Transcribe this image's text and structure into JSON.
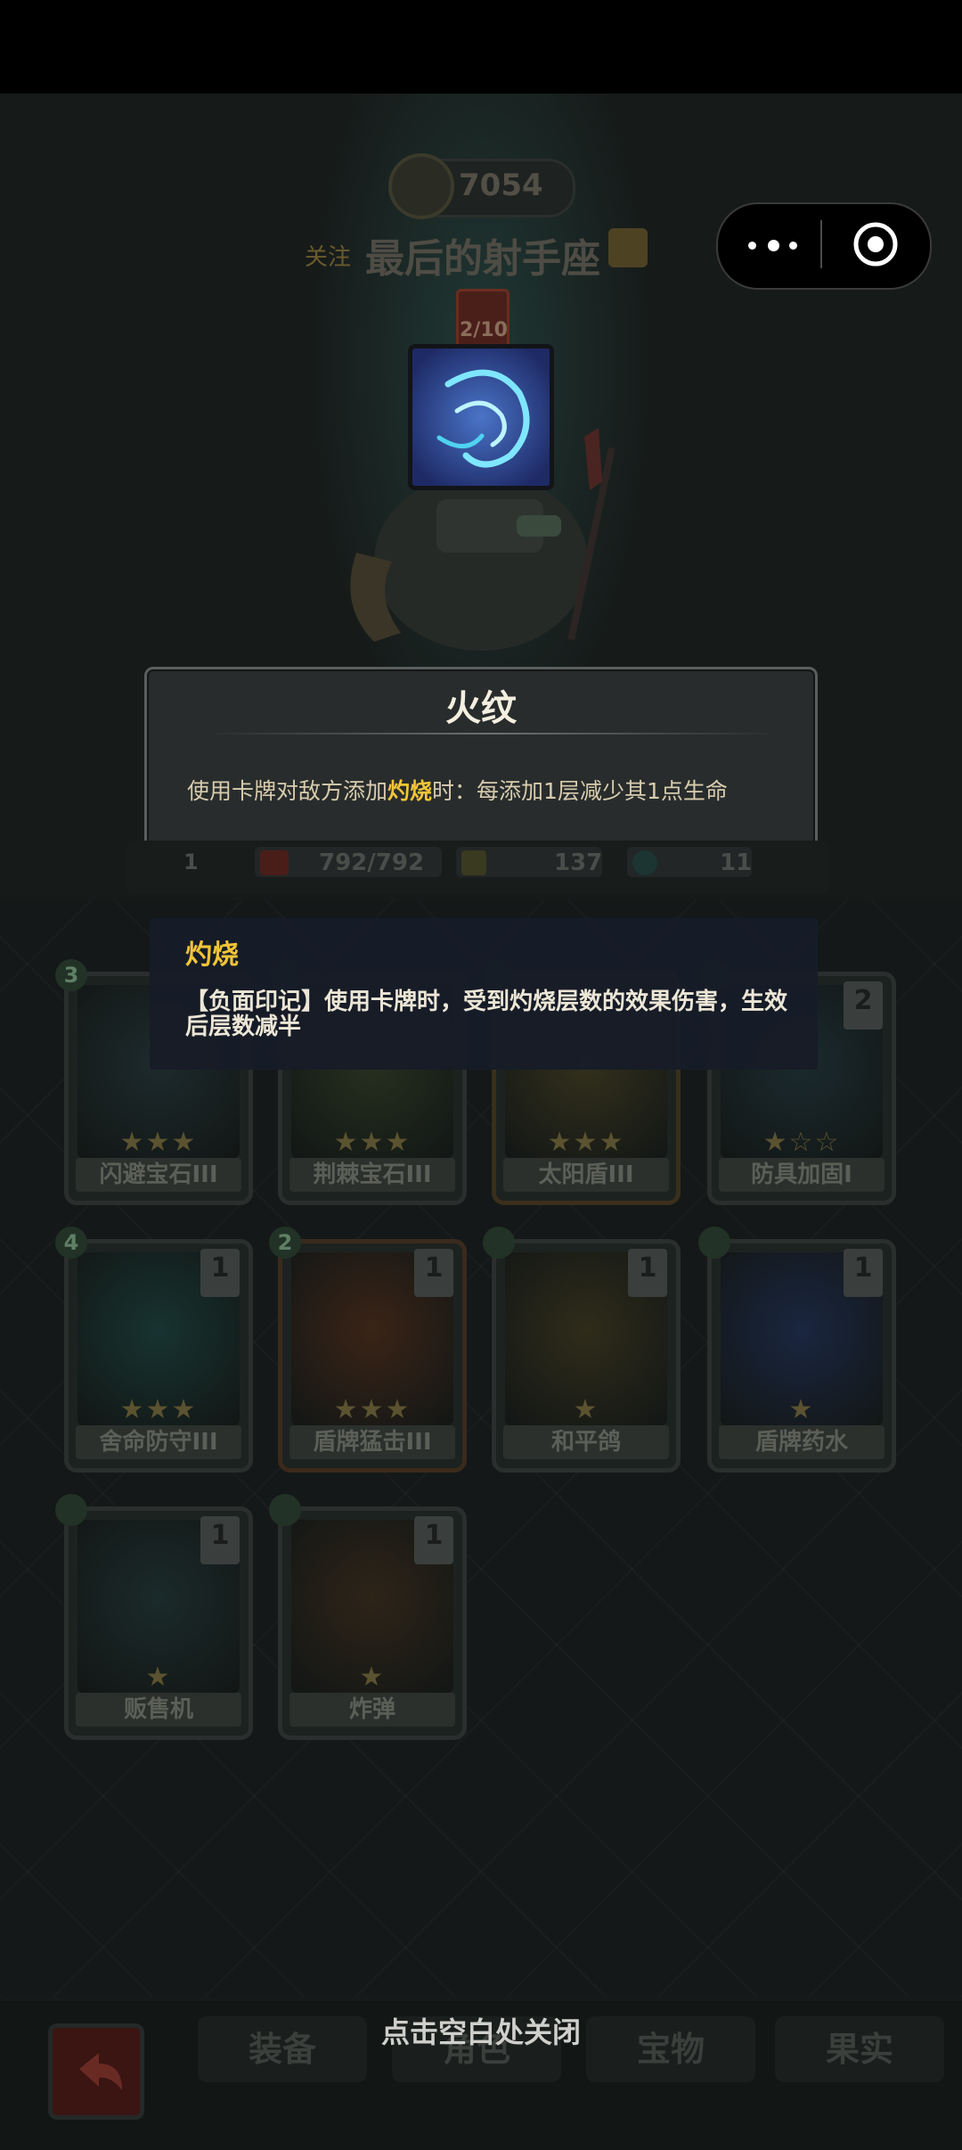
{
  "header": {
    "gold": "7054",
    "follow_label": "关注",
    "player_name": "最后的射手座",
    "badge_count": "2/10"
  },
  "capsule": {
    "menu_icon": "more-dots-icon",
    "close_icon": "target-close-icon"
  },
  "skill_tooltip": {
    "title": "火纹",
    "desc_before": "使用卡牌对敌方添加",
    "desc_keyword": "灼烧",
    "desc_after": "时：每添加1层减少其1点生命"
  },
  "stats": {
    "hp": "792/792",
    "attack": "137",
    "shield": "11",
    "level": "1"
  },
  "keyword_tooltip": {
    "title": "灼烧",
    "desc": "【负面印记】使用卡牌时，受到灼烧层数的效果伤害，生效后层数减半"
  },
  "cards": [
    {
      "name": "闪避宝石III",
      "cost": "3",
      "stars": "★★★",
      "level": ""
    },
    {
      "name": "荆棘宝石III",
      "cost": "",
      "stars": "★★★",
      "level": ""
    },
    {
      "name": "太阳盾III",
      "cost": "",
      "stars": "★★★",
      "level": ""
    },
    {
      "name": "防具加固I",
      "cost": "",
      "stars": "★☆☆",
      "level": "2"
    },
    {
      "name": "舍命防守III",
      "cost": "4",
      "stars": "★★★",
      "level": "1"
    },
    {
      "name": "盾牌猛击III",
      "cost": "2",
      "stars": "★★★",
      "level": "1"
    },
    {
      "name": "和平鸽",
      "cost": "",
      "stars": "★",
      "level": "1"
    },
    {
      "name": "盾牌药水",
      "cost": "",
      "stars": "★",
      "level": "1"
    },
    {
      "name": "贩售机",
      "cost": "",
      "stars": "★",
      "level": "1"
    },
    {
      "name": "炸弹",
      "cost": "",
      "stars": "★",
      "level": "1"
    }
  ],
  "bottom": {
    "close_hint": "点击空白处关闭",
    "tabs": [
      "装备",
      "角色",
      "宝物",
      "果实"
    ]
  },
  "colors": {
    "highlight": "#f2c438",
    "tooltip_bg": "#282c2c",
    "keyword_bg": "#171c28"
  }
}
